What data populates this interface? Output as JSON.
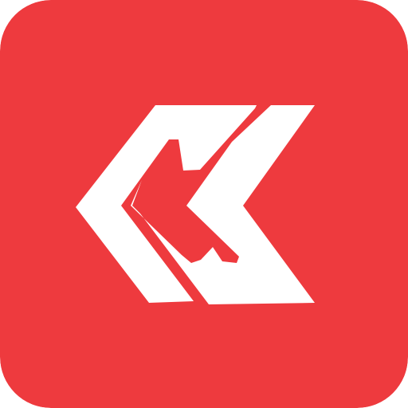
{
  "app_icon": {
    "icon": "double-chevron-left-logo-icon",
    "background_color": "#EE3A3E",
    "glyph_color": "#FFFFFF"
  }
}
